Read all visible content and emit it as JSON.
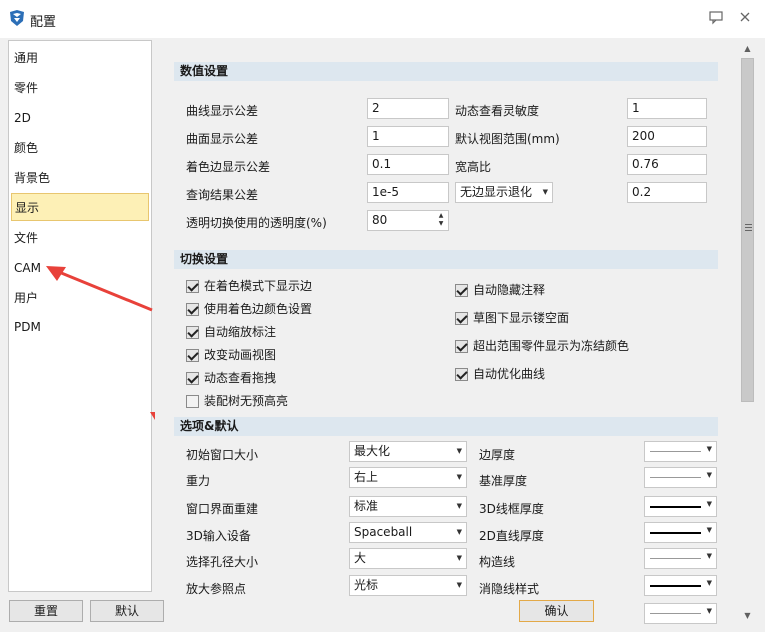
{
  "window": {
    "title": "配置",
    "help_icon": "help-bubble-icon",
    "close_icon": "close-icon"
  },
  "sidebar": {
    "items": [
      {
        "label": "通用"
      },
      {
        "label": "零件"
      },
      {
        "label": "2D"
      },
      {
        "label": "颜色"
      },
      {
        "label": "背景色"
      },
      {
        "label": "显示",
        "active": true
      },
      {
        "label": "文件"
      },
      {
        "label": "CAM"
      },
      {
        "label": "用户"
      },
      {
        "label": "PDM"
      }
    ]
  },
  "numeric": {
    "header": "数值设置",
    "curve_tol_label": "曲线显示公差",
    "curve_tol_value": "2",
    "surface_tol_label": "曲面显示公差",
    "surface_tol_value": "1",
    "shade_edge_tol_label": "着色边显示公差",
    "shade_edge_tol_value": "0.1",
    "query_tol_label": "查询结果公差",
    "query_tol_value": "1e-5",
    "transparency_label": "透明切换使用的透明度(%)",
    "transparency_value": "80",
    "dyn_sens_label": "动态查看灵敏度",
    "dyn_sens_value": "1",
    "default_view_label": "默认视图范围(mm)",
    "default_view_value": "200",
    "aspect_label": "宽高比",
    "aspect_value": "0.76",
    "edge_mode_select": "无边显示退化",
    "edge_mode_value": "0.2"
  },
  "toggle": {
    "header": "切换设置",
    "left": [
      {
        "label": "在着色模式下显示边",
        "checked": true
      },
      {
        "label": "使用着色边颜色设置",
        "checked": true
      },
      {
        "label": "自动缩放标注",
        "checked": true
      },
      {
        "label": "改变动画视图",
        "checked": true
      },
      {
        "label": "动态查看拖拽",
        "checked": true
      },
      {
        "label": "装配树无预高亮",
        "checked": false
      }
    ],
    "right": [
      {
        "label": "自动隐藏注释",
        "checked": true
      },
      {
        "label": "草图下显示镂空面",
        "checked": true
      },
      {
        "label": "超出范围零件显示为冻结颜色",
        "checked": true
      },
      {
        "label": "自动优化曲线",
        "checked": true
      }
    ]
  },
  "options": {
    "header": "选项&默认",
    "rows": [
      {
        "label": "初始窗口大小",
        "value": "最大化",
        "right_label": "边厚度",
        "line": "thin"
      },
      {
        "label": "重力",
        "value": "右上",
        "right_label": "基准厚度",
        "line": "thin"
      },
      {
        "label": "窗口界面重建",
        "value": "标准",
        "right_label": "3D线框厚度",
        "line": "thick"
      },
      {
        "label": "3D输入设备",
        "value": "Spaceball",
        "right_label": "2D直线厚度",
        "line": "thick"
      },
      {
        "label": "选择孔径大小",
        "value": "大",
        "right_label": "构造线",
        "line": "thin"
      },
      {
        "label": "放大参照点",
        "value": "光标",
        "right_label": "消隐线样式",
        "line": "thick"
      }
    ],
    "extra_line": "thin"
  },
  "buttons": {
    "reset": "重置",
    "default": "默认",
    "ok": "确认"
  },
  "colors": {
    "active_item_bg": "#fdf0b6",
    "section_bg": "#dde7ef",
    "annotation_red": "#e8413a"
  }
}
